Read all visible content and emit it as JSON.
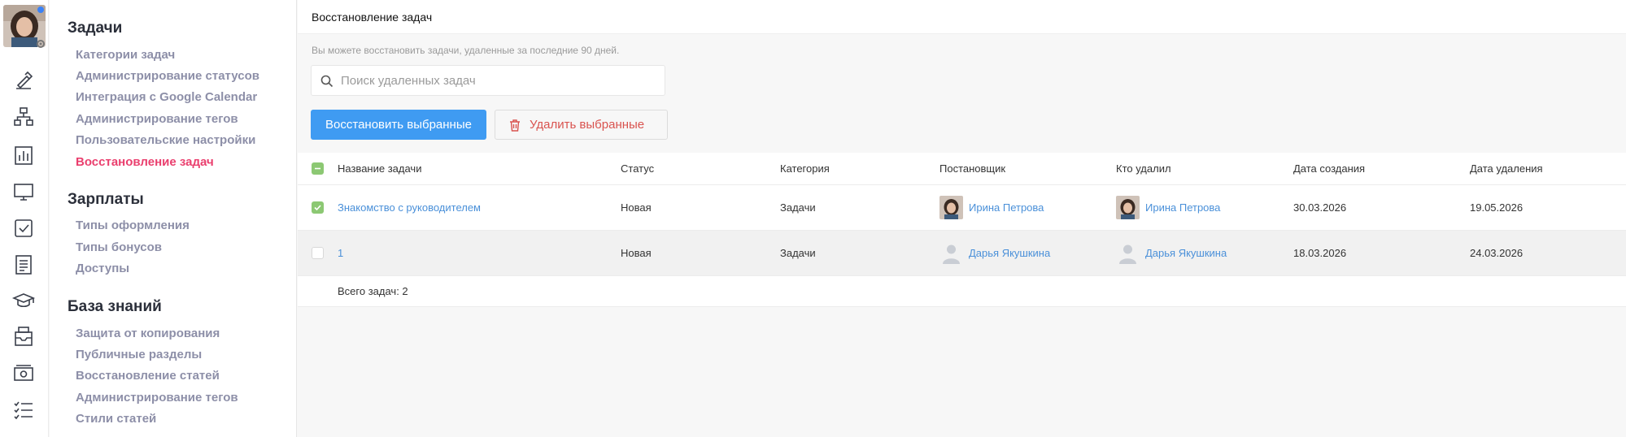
{
  "rail": {
    "icons": [
      "avatar",
      "edit-icon",
      "org-chart-icon",
      "chart-icon",
      "monitor-icon",
      "checkbox-icon",
      "document-icon",
      "graduation-cap-icon",
      "inbox-icon",
      "money-icon",
      "checklist-icon"
    ]
  },
  "sidebar": {
    "sections": [
      {
        "title": "Задачи",
        "items": [
          "Категории задач",
          "Администрирование статусов",
          "Интеграция с Google Calendar",
          "Администрирование тегов",
          "Пользовательские настройки",
          "Восстановление задач"
        ]
      },
      {
        "title": "Зарплаты",
        "items": [
          "Типы оформления",
          "Типы бонусов",
          "Доступы"
        ]
      },
      {
        "title": "База знаний",
        "items": [
          "Защита от копирования",
          "Публичные разделы",
          "Восстановление статей",
          "Администрирование тегов",
          "Стили статей"
        ]
      }
    ],
    "active_item": "Восстановление задач"
  },
  "main": {
    "title": "Восстановление задач",
    "hint": "Вы можете восстановить задачи, удаленные за последние 90 дней.",
    "search_placeholder": "Поиск удаленных задач",
    "restore_button": "Восстановить выбранные",
    "delete_button": "Удалить выбранные"
  },
  "table": {
    "columns": [
      "Название задачи",
      "Статус",
      "Категория",
      "Постановщик",
      "Кто удалил",
      "Дата создания",
      "Дата удаления"
    ],
    "rows": [
      {
        "checked": true,
        "name": "Знакомство с руководителем",
        "status": "Новая",
        "category": "Задачи",
        "creator": "Ирина Петрова",
        "deleted_by": "Ирина Петрова",
        "created": "30.03.2026",
        "deleted": "19.05.2026"
      },
      {
        "checked": false,
        "name": "1",
        "status": "Новая",
        "category": "Задачи",
        "creator": "Дарья Якушкина",
        "deleted_by": "Дарья Якушкина",
        "created": "18.03.2026",
        "deleted": "24.03.2026"
      }
    ],
    "total": "Всего задач: 2"
  },
  "colors": {
    "accent_blue": "#3f9bf2",
    "active_link": "#ea3f6e",
    "delete_red": "#d9534f",
    "check_green": "#8cc873",
    "link_blue": "#4a90d9"
  }
}
